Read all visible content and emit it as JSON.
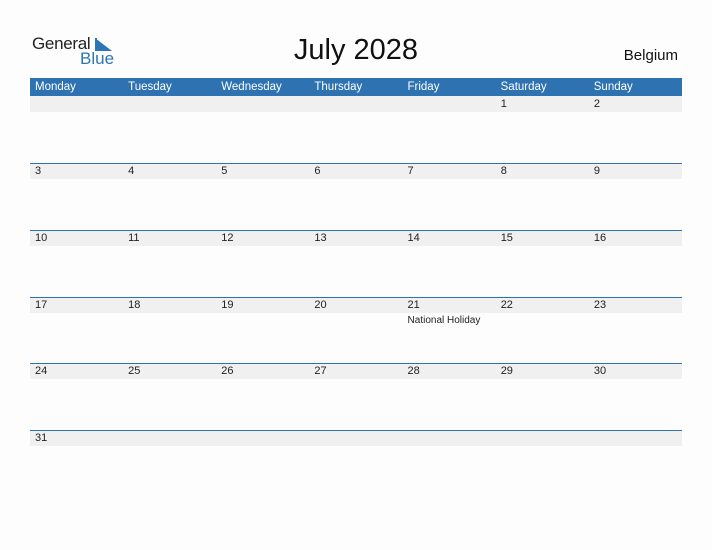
{
  "logo": {
    "word1": "General",
    "word2": "Blue"
  },
  "title": "July 2028",
  "country": "Belgium",
  "colors": {
    "accent": "#2e72b2",
    "band": "#f0f0f0"
  },
  "weekdays": [
    "Monday",
    "Tuesday",
    "Wednesday",
    "Thursday",
    "Friday",
    "Saturday",
    "Sunday"
  ],
  "weeks": [
    [
      {
        "d": ""
      },
      {
        "d": ""
      },
      {
        "d": ""
      },
      {
        "d": ""
      },
      {
        "d": ""
      },
      {
        "d": "1"
      },
      {
        "d": "2"
      }
    ],
    [
      {
        "d": "3"
      },
      {
        "d": "4"
      },
      {
        "d": "5"
      },
      {
        "d": "6"
      },
      {
        "d": "7"
      },
      {
        "d": "8"
      },
      {
        "d": "9"
      }
    ],
    [
      {
        "d": "10"
      },
      {
        "d": "11"
      },
      {
        "d": "12"
      },
      {
        "d": "13"
      },
      {
        "d": "14"
      },
      {
        "d": "15"
      },
      {
        "d": "16"
      }
    ],
    [
      {
        "d": "17"
      },
      {
        "d": "18"
      },
      {
        "d": "19"
      },
      {
        "d": "20"
      },
      {
        "d": "21",
        "event": "National Holiday"
      },
      {
        "d": "22"
      },
      {
        "d": "23"
      }
    ],
    [
      {
        "d": "24"
      },
      {
        "d": "25"
      },
      {
        "d": "26"
      },
      {
        "d": "27"
      },
      {
        "d": "28"
      },
      {
        "d": "29"
      },
      {
        "d": "30"
      }
    ],
    [
      {
        "d": "31"
      },
      {
        "d": ""
      },
      {
        "d": ""
      },
      {
        "d": ""
      },
      {
        "d": ""
      },
      {
        "d": ""
      },
      {
        "d": ""
      }
    ]
  ]
}
